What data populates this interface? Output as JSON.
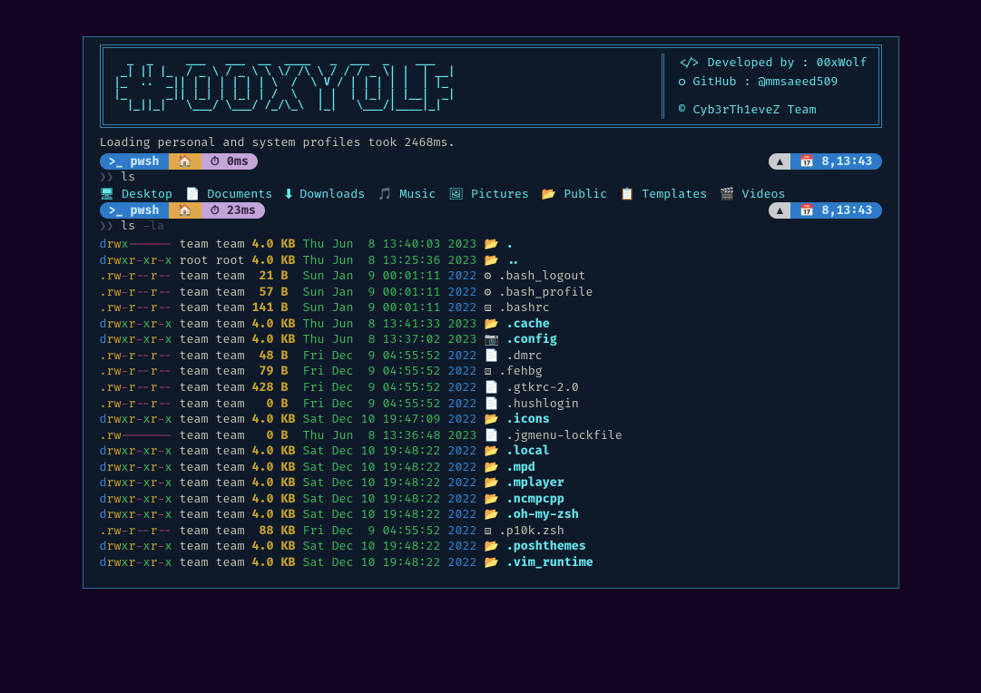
{
  "banner": {
    "title": "# 00XWOLF",
    "info": {
      "dev": "Developed by : 00xWolf",
      "github": "GitHub : @mmsaeed509",
      "team": "Cyb3rTh1eveZ Team"
    }
  },
  "loading": "Loading personal and system profiles took 2468ms.",
  "prompt1": {
    "shell": ">_ pwsh",
    "dir": "🏠",
    "dur": "⏱ 0ms",
    "clock": "📅  8,13:43"
  },
  "cmd1": "ls",
  "folders": [
    {
      "icon": "🖥",
      "name": "Desktop"
    },
    {
      "icon": "📄",
      "name": "Documents"
    },
    {
      "icon": "⬇",
      "name": "Downloads"
    },
    {
      "icon": "🎵",
      "name": "Music"
    },
    {
      "icon": "🖼",
      "name": "Pictures"
    },
    {
      "icon": "📂",
      "name": "Public"
    },
    {
      "icon": "📋",
      "name": "Templates"
    },
    {
      "icon": "🎬",
      "name": "Videos"
    }
  ],
  "prompt2": {
    "shell": ">_ pwsh",
    "dir": "🏠",
    "dur": "⏱ 23ms",
    "clock": "📅  8,13:43"
  },
  "cmd2": {
    "base": "ls",
    "flag": "-la"
  },
  "entries": [
    {
      "type": "dir",
      "perm": "drwx------",
      "owner": "team team",
      "size": "4.0 KB",
      "date": "Thu Jun  8 13:40:03",
      "year": "2023",
      "recent": true,
      "icon": "📂",
      "name": ".",
      "dir": true
    },
    {
      "type": "dir",
      "perm": "drwxr-xr-x",
      "owner": "root root",
      "size": "4.0 KB",
      "date": "Thu Jun  8 13:25:36",
      "year": "2023",
      "recent": true,
      "icon": "📂",
      "name": "..",
      "dir": true
    },
    {
      "type": "file",
      "perm": ".rw-r--r--",
      "owner": "team team",
      "size": " 21 B ",
      "date": "Sun Jan  9 00:01:11",
      "year": "2022",
      "recent": false,
      "icon": "⚙",
      "name": ".bash_logout",
      "dir": false
    },
    {
      "type": "file",
      "perm": ".rw-r--r--",
      "owner": "team team",
      "size": " 57 B ",
      "date": "Sun Jan  9 00:01:11",
      "year": "2022",
      "recent": false,
      "icon": "⚙",
      "name": ".bash_profile",
      "dir": false
    },
    {
      "type": "file",
      "perm": ".rw-r--r--",
      "owner": "team team",
      "size": "141 B ",
      "date": "Sun Jan  9 00:01:11",
      "year": "2022",
      "recent": false,
      "icon": "⧈",
      "name": ".bashrc",
      "dir": false
    },
    {
      "type": "dir",
      "perm": "drwxr-xr-x",
      "owner": "team team",
      "size": "4.0 KB",
      "date": "Thu Jun  8 13:41:33",
      "year": "2023",
      "recent": true,
      "icon": "📂",
      "name": ".cache",
      "dir": true
    },
    {
      "type": "dir",
      "perm": "drwxr-xr-x",
      "owner": "team team",
      "size": "4.0 KB",
      "date": "Thu Jun  8 13:37:02",
      "year": "2023",
      "recent": true,
      "icon": "📷",
      "name": ".config",
      "dir": true
    },
    {
      "type": "file",
      "perm": ".rw-r--r--",
      "owner": "team team",
      "size": " 48 B ",
      "date": "Fri Dec  9 04:55:52",
      "year": "2022",
      "recent": false,
      "icon": "📄",
      "name": ".dmrc",
      "dir": false
    },
    {
      "type": "file",
      "perm": ".rw-r--r--",
      "owner": "team team",
      "size": " 79 B ",
      "date": "Fri Dec  9 04:55:52",
      "year": "2022",
      "recent": false,
      "icon": "⧈",
      "name": ".fehbg",
      "dir": false
    },
    {
      "type": "file",
      "perm": ".rw-r--r--",
      "owner": "team team",
      "size": "428 B ",
      "date": "Fri Dec  9 04:55:52",
      "year": "2022",
      "recent": false,
      "icon": "📄",
      "name": ".gtkrc-2.0",
      "dir": false
    },
    {
      "type": "file",
      "perm": ".rw-r--r--",
      "owner": "team team",
      "size": "  0 B ",
      "date": "Fri Dec  9 04:55:52",
      "year": "2022",
      "recent": false,
      "icon": "📄",
      "name": ".hushlogin",
      "dir": false
    },
    {
      "type": "dir",
      "perm": "drwxr-xr-x",
      "owner": "team team",
      "size": "4.0 KB",
      "date": "Sat Dec 10 19:47:09",
      "year": "2022",
      "recent": false,
      "icon": "📂",
      "name": ".icons",
      "dir": true
    },
    {
      "type": "file",
      "perm": ".rw-------",
      "owner": "team team",
      "size": "  0 B ",
      "date": "Thu Jun  8 13:36:48",
      "year": "2023",
      "recent": true,
      "icon": "📄",
      "name": ".jgmenu-lockfile",
      "dir": false
    },
    {
      "type": "dir",
      "perm": "drwxr-xr-x",
      "owner": "team team",
      "size": "4.0 KB",
      "date": "Sat Dec 10 19:48:22",
      "year": "2022",
      "recent": false,
      "icon": "📂",
      "name": ".local",
      "dir": true
    },
    {
      "type": "dir",
      "perm": "drwxr-xr-x",
      "owner": "team team",
      "size": "4.0 KB",
      "date": "Sat Dec 10 19:48:22",
      "year": "2022",
      "recent": false,
      "icon": "📂",
      "name": ".mpd",
      "dir": true
    },
    {
      "type": "dir",
      "perm": "drwxr-xr-x",
      "owner": "team team",
      "size": "4.0 KB",
      "date": "Sat Dec 10 19:48:22",
      "year": "2022",
      "recent": false,
      "icon": "📂",
      "name": ".mplayer",
      "dir": true
    },
    {
      "type": "dir",
      "perm": "drwxr-xr-x",
      "owner": "team team",
      "size": "4.0 KB",
      "date": "Sat Dec 10 19:48:22",
      "year": "2022",
      "recent": false,
      "icon": "📂",
      "name": ".ncmpcpp",
      "dir": true
    },
    {
      "type": "dir",
      "perm": "drwxr-xr-x",
      "owner": "team team",
      "size": "4.0 KB",
      "date": "Sat Dec 10 19:48:22",
      "year": "2022",
      "recent": false,
      "icon": "📂",
      "name": ".oh-my-zsh",
      "dir": true
    },
    {
      "type": "file",
      "perm": ".rw-r--r--",
      "owner": "team team",
      "size": " 88 KB",
      "date": "Fri Dec  9 04:55:52",
      "year": "2022",
      "recent": false,
      "icon": "⧈",
      "name": ".p10k.zsh",
      "dir": false
    },
    {
      "type": "dir",
      "perm": "drwxr-xr-x",
      "owner": "team team",
      "size": "4.0 KB",
      "date": "Sat Dec 10 19:48:22",
      "year": "2022",
      "recent": false,
      "icon": "📂",
      "name": ".poshthemes",
      "dir": true
    },
    {
      "type": "dir",
      "perm": "drwxr-xr-x",
      "owner": "team team",
      "size": "4.0 KB",
      "date": "Sat Dec 10 19:48:22",
      "year": "2022",
      "recent": false,
      "icon": "📂",
      "name": ".vim_runtime",
      "dir": true
    }
  ]
}
